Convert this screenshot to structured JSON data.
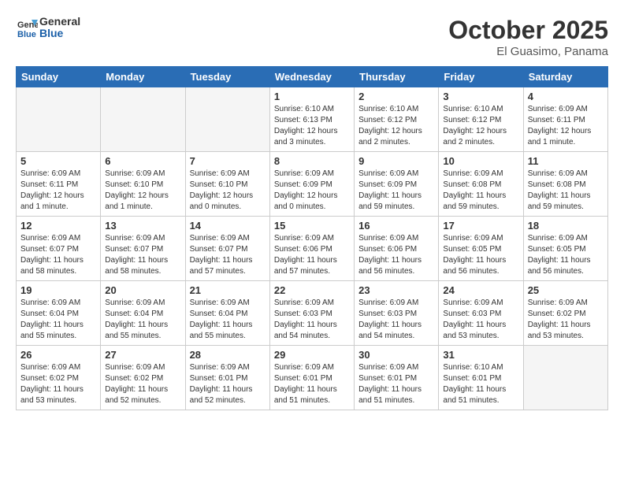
{
  "header": {
    "logo_line1": "General",
    "logo_line2": "Blue",
    "month": "October 2025",
    "location": "El Guasimo, Panama"
  },
  "weekdays": [
    "Sunday",
    "Monday",
    "Tuesday",
    "Wednesday",
    "Thursday",
    "Friday",
    "Saturday"
  ],
  "weeks": [
    [
      {
        "day": "",
        "info": ""
      },
      {
        "day": "",
        "info": ""
      },
      {
        "day": "",
        "info": ""
      },
      {
        "day": "1",
        "info": "Sunrise: 6:10 AM\nSunset: 6:13 PM\nDaylight: 12 hours\nand 3 minutes."
      },
      {
        "day": "2",
        "info": "Sunrise: 6:10 AM\nSunset: 6:12 PM\nDaylight: 12 hours\nand 2 minutes."
      },
      {
        "day": "3",
        "info": "Sunrise: 6:10 AM\nSunset: 6:12 PM\nDaylight: 12 hours\nand 2 minutes."
      },
      {
        "day": "4",
        "info": "Sunrise: 6:09 AM\nSunset: 6:11 PM\nDaylight: 12 hours\nand 1 minute."
      }
    ],
    [
      {
        "day": "5",
        "info": "Sunrise: 6:09 AM\nSunset: 6:11 PM\nDaylight: 12 hours\nand 1 minute."
      },
      {
        "day": "6",
        "info": "Sunrise: 6:09 AM\nSunset: 6:10 PM\nDaylight: 12 hours\nand 1 minute."
      },
      {
        "day": "7",
        "info": "Sunrise: 6:09 AM\nSunset: 6:10 PM\nDaylight: 12 hours\nand 0 minutes."
      },
      {
        "day": "8",
        "info": "Sunrise: 6:09 AM\nSunset: 6:09 PM\nDaylight: 12 hours\nand 0 minutes."
      },
      {
        "day": "9",
        "info": "Sunrise: 6:09 AM\nSunset: 6:09 PM\nDaylight: 11 hours\nand 59 minutes."
      },
      {
        "day": "10",
        "info": "Sunrise: 6:09 AM\nSunset: 6:08 PM\nDaylight: 11 hours\nand 59 minutes."
      },
      {
        "day": "11",
        "info": "Sunrise: 6:09 AM\nSunset: 6:08 PM\nDaylight: 11 hours\nand 59 minutes."
      }
    ],
    [
      {
        "day": "12",
        "info": "Sunrise: 6:09 AM\nSunset: 6:07 PM\nDaylight: 11 hours\nand 58 minutes."
      },
      {
        "day": "13",
        "info": "Sunrise: 6:09 AM\nSunset: 6:07 PM\nDaylight: 11 hours\nand 58 minutes."
      },
      {
        "day": "14",
        "info": "Sunrise: 6:09 AM\nSunset: 6:07 PM\nDaylight: 11 hours\nand 57 minutes."
      },
      {
        "day": "15",
        "info": "Sunrise: 6:09 AM\nSunset: 6:06 PM\nDaylight: 11 hours\nand 57 minutes."
      },
      {
        "day": "16",
        "info": "Sunrise: 6:09 AM\nSunset: 6:06 PM\nDaylight: 11 hours\nand 56 minutes."
      },
      {
        "day": "17",
        "info": "Sunrise: 6:09 AM\nSunset: 6:05 PM\nDaylight: 11 hours\nand 56 minutes."
      },
      {
        "day": "18",
        "info": "Sunrise: 6:09 AM\nSunset: 6:05 PM\nDaylight: 11 hours\nand 56 minutes."
      }
    ],
    [
      {
        "day": "19",
        "info": "Sunrise: 6:09 AM\nSunset: 6:04 PM\nDaylight: 11 hours\nand 55 minutes."
      },
      {
        "day": "20",
        "info": "Sunrise: 6:09 AM\nSunset: 6:04 PM\nDaylight: 11 hours\nand 55 minutes."
      },
      {
        "day": "21",
        "info": "Sunrise: 6:09 AM\nSunset: 6:04 PM\nDaylight: 11 hours\nand 55 minutes."
      },
      {
        "day": "22",
        "info": "Sunrise: 6:09 AM\nSunset: 6:03 PM\nDaylight: 11 hours\nand 54 minutes."
      },
      {
        "day": "23",
        "info": "Sunrise: 6:09 AM\nSunset: 6:03 PM\nDaylight: 11 hours\nand 54 minutes."
      },
      {
        "day": "24",
        "info": "Sunrise: 6:09 AM\nSunset: 6:03 PM\nDaylight: 11 hours\nand 53 minutes."
      },
      {
        "day": "25",
        "info": "Sunrise: 6:09 AM\nSunset: 6:02 PM\nDaylight: 11 hours\nand 53 minutes."
      }
    ],
    [
      {
        "day": "26",
        "info": "Sunrise: 6:09 AM\nSunset: 6:02 PM\nDaylight: 11 hours\nand 53 minutes."
      },
      {
        "day": "27",
        "info": "Sunrise: 6:09 AM\nSunset: 6:02 PM\nDaylight: 11 hours\nand 52 minutes."
      },
      {
        "day": "28",
        "info": "Sunrise: 6:09 AM\nSunset: 6:01 PM\nDaylight: 11 hours\nand 52 minutes."
      },
      {
        "day": "29",
        "info": "Sunrise: 6:09 AM\nSunset: 6:01 PM\nDaylight: 11 hours\nand 51 minutes."
      },
      {
        "day": "30",
        "info": "Sunrise: 6:09 AM\nSunset: 6:01 PM\nDaylight: 11 hours\nand 51 minutes."
      },
      {
        "day": "31",
        "info": "Sunrise: 6:10 AM\nSunset: 6:01 PM\nDaylight: 11 hours\nand 51 minutes."
      },
      {
        "day": "",
        "info": ""
      }
    ]
  ]
}
